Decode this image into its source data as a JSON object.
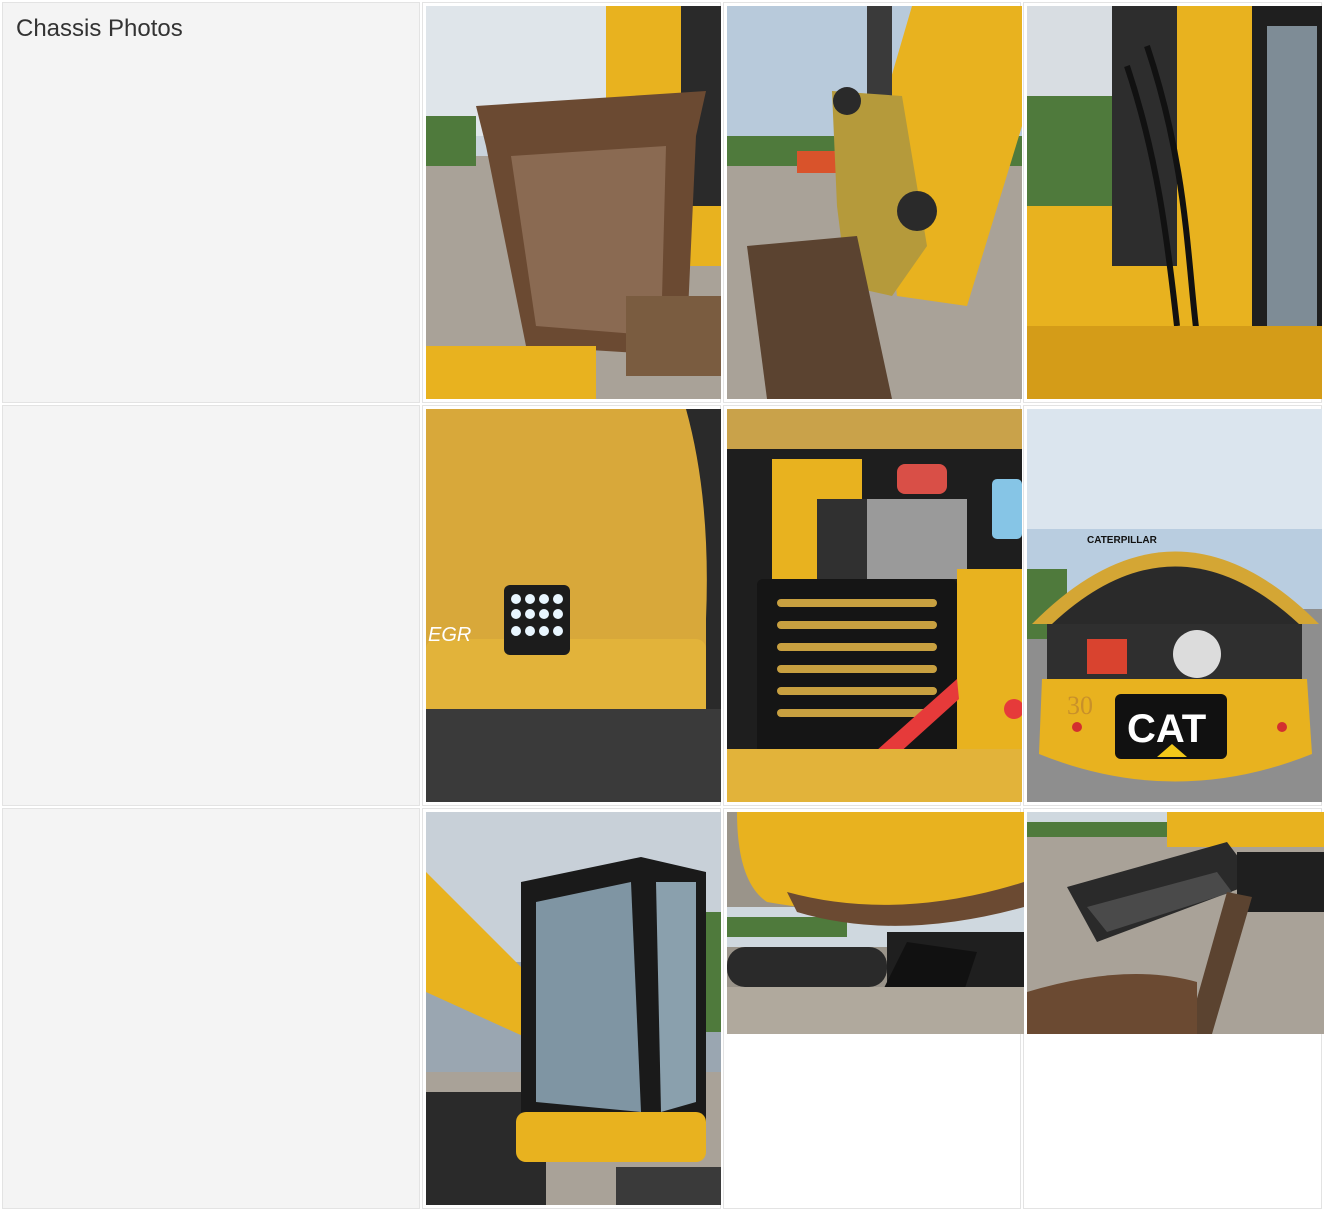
{
  "section": {
    "title": "Chassis Photos"
  },
  "photos": [
    {
      "name": "bucket-front-photo",
      "alt": "Excavator bucket close-up"
    },
    {
      "name": "bucket-linkage-photo",
      "alt": "Bucket linkage and stick"
    },
    {
      "name": "boom-hydraulics-photo",
      "alt": "Boom hoses and cab side"
    },
    {
      "name": "work-light-photo",
      "alt": "LED work light on counterweight panel"
    },
    {
      "name": "engine-compartment-photo",
      "alt": "Engine compartment with grille"
    },
    {
      "name": "rear-counterweight-photo",
      "alt": "Rear with open engine hood"
    },
    {
      "name": "cab-door-photo",
      "alt": "Operator cab door open"
    },
    {
      "name": "undercarriage-photo",
      "alt": "Undercarriage and swing frame"
    },
    {
      "name": "track-blade-photo",
      "alt": "Track and blade"
    }
  ],
  "overlays": {
    "cat_logo": "CAT",
    "model_number": "30",
    "brand_on_cab": "CATERPILLAR",
    "side_decal": "EGR"
  },
  "colors": {
    "cat_yellow": "#e8b21f",
    "sky": "#9fb8cf",
    "gravel": "#a9a298",
    "rust": "#6b4a32",
    "track_black": "#2a2a2a"
  }
}
